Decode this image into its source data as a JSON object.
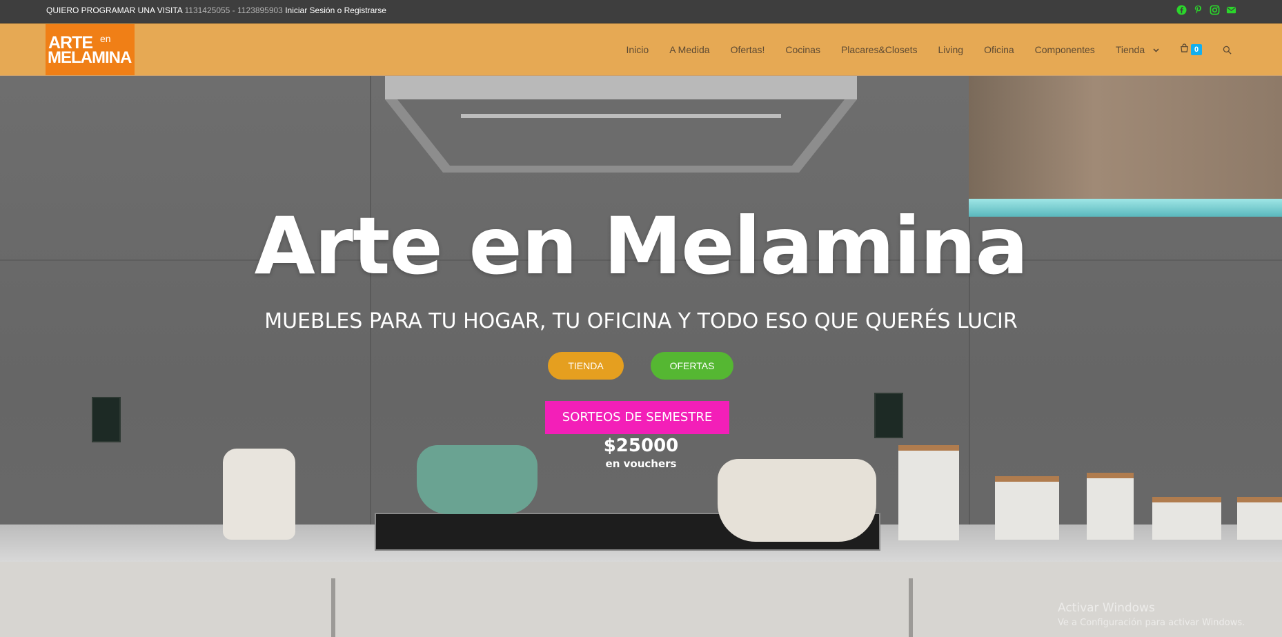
{
  "topbar": {
    "visit_text": "QUIERO PROGRAMAR UNA VISITA",
    "phones": "1131425055 - 1123895903",
    "login": "Iniciar Sesión",
    "or": "o",
    "register": "Registrarse",
    "social_color": "#2bd62b",
    "social_icons": [
      "facebook-icon",
      "pinterest-icon",
      "instagram-icon",
      "envelope-icon"
    ]
  },
  "header": {
    "background": "#e6a954",
    "logo": {
      "line1": "ARTE",
      "line1_small": "en",
      "line2": "MELAMINA",
      "background": "#f07f16"
    },
    "nav": [
      "Inicio",
      "A Medida",
      "Ofertas!",
      "Cocinas",
      "Placares&Closets",
      "Living",
      "Oficina",
      "Componentes",
      "Tienda"
    ],
    "cart_count": "0",
    "cart_badge_color": "#13aff0"
  },
  "hero": {
    "title": "Arte en Melamina",
    "subtitle": "MUEBLES PARA TU HOGAR, TU OFICINA Y TODO ESO QUE QUERÉS LUCIR",
    "btn_tienda": "TIENDA",
    "btn_ofertas": "OFERTAS",
    "btn_sorteos": "SORTEOS DE SEMESTRE",
    "prize_amount": "$25000",
    "prize_label": "en vouchers",
    "colors": {
      "tienda": "#e59f1f",
      "ofertas": "#55b732",
      "sorteos": "#f31fb8"
    }
  },
  "watermark": {
    "title": "Activar Windows",
    "text": "Ve a Configuración para activar Windows."
  }
}
